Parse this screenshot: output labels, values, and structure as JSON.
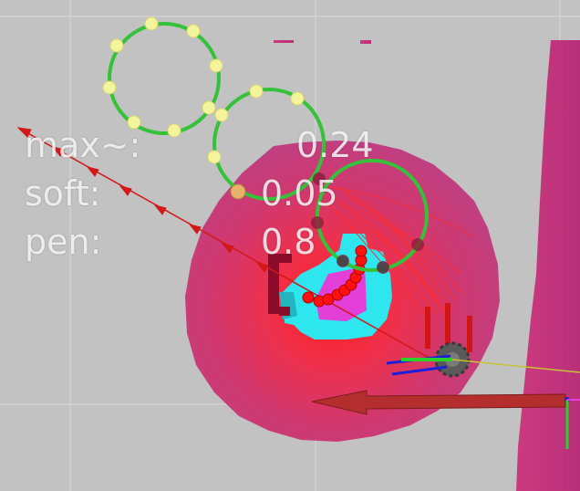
{
  "overlay": {
    "max_label": "max~:",
    "max_value": "0.24",
    "soft_label": "soft:",
    "soft_value": "0.05",
    "pen_label": "pen:",
    "pen_value": "0.8"
  },
  "colors": {
    "background": "#c2c2c2",
    "grid": "#d8d8d8",
    "costmap_outer": "#c0337a",
    "costmap_inner": "#ff2020",
    "inflation_cyan": "#29e8ee",
    "footprint_magenta": "#e83cd8",
    "obstacle_dark": "#8a0b2a",
    "trajectory_red": "#ff1010",
    "circle_green": "#35c43a",
    "waypoint_yellow": "#f4f59a",
    "pose_arrow": "#b02a2a",
    "path_line": "#c8c234"
  }
}
